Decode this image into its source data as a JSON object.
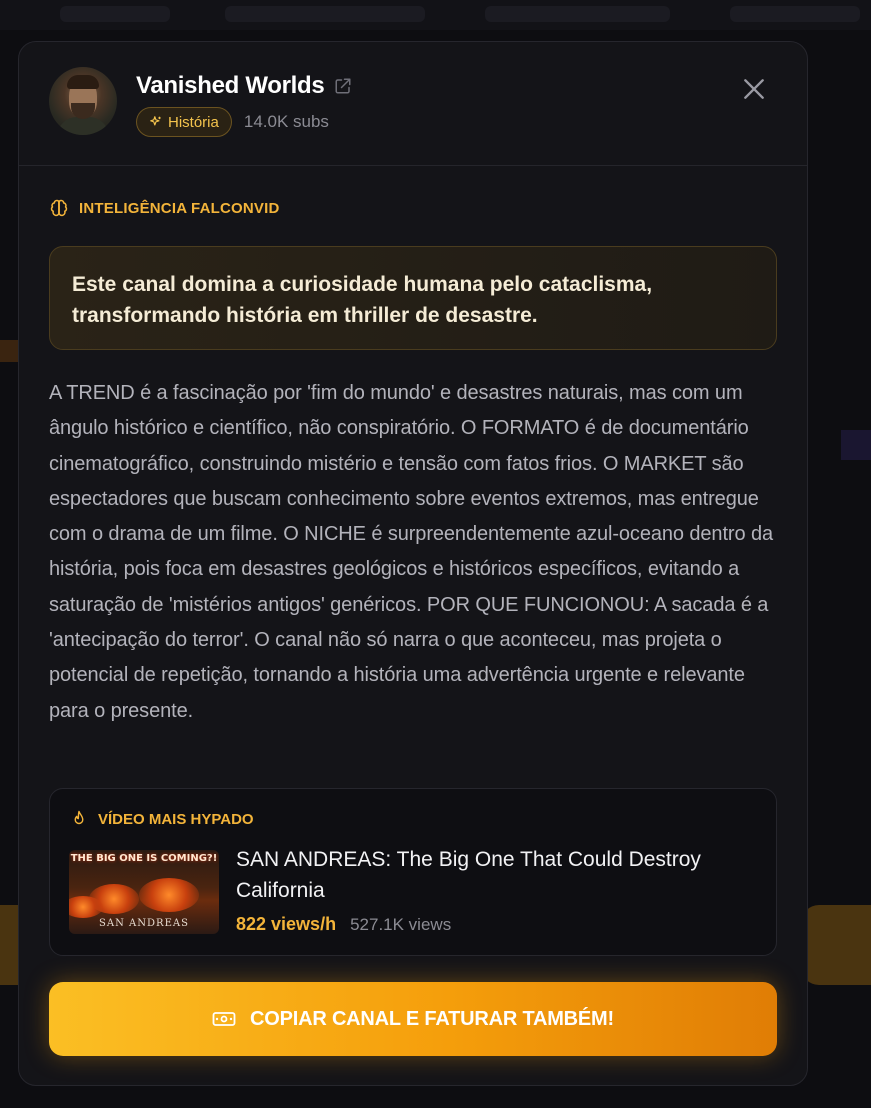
{
  "channel": {
    "name": "Vanished Worlds",
    "category": "História",
    "subs": "14.0K subs"
  },
  "intelligence": {
    "label": "INTELIGÊNCIA FALCONVID",
    "highlight": "Este canal domina a curiosidade humana pelo cataclisma, transformando história em thriller de desastre.",
    "analysis": "A TREND é a fascinação por 'fim do mundo' e desastres naturais, mas com um ângulo histórico e científico, não conspiratório. O FORMATO é de documentário cinematográfico, construindo mistério e tensão com fatos frios. O MARKET são espectadores que buscam conhecimento sobre eventos extremos, mas entregue com o drama de um filme. O NICHE é surpreendentemente azul-oceano dentro da história, pois foca em desastres geológicos e históricos específicos, evitando a saturação de 'mistérios antigos' genéricos. POR QUE FUNCIONOU: A sacada é a 'antecipação do terror'. O canal não só narra o que aconteceu, mas projeta o potencial de repetição, tornando a história uma advertência urgente e relevante para o presente."
  },
  "top_video": {
    "label": "VÍDEO MAIS HYPADO",
    "thumbnail_title": "THE BIG ONE IS COMING?!",
    "thumbnail_subtitle": "SAN ANDREAS",
    "title": "SAN ANDREAS: The Big One That Could Destroy California",
    "views_per_hour": "822 views/h",
    "views": "527.1K views"
  },
  "cta": {
    "label": "COPIAR CANAL E FATURAR TAMBÉM!"
  },
  "colors": {
    "accent": "#f3b43a",
    "cta_start": "#fbbf24",
    "cta_end": "#e07d05",
    "modal_bg": "#141418"
  },
  "icons": {
    "external": "external-link-icon",
    "category": "sparkles-icon",
    "close": "close-icon",
    "intelligence": "brain-icon",
    "top_video": "flame-icon",
    "cta": "money-icon"
  }
}
